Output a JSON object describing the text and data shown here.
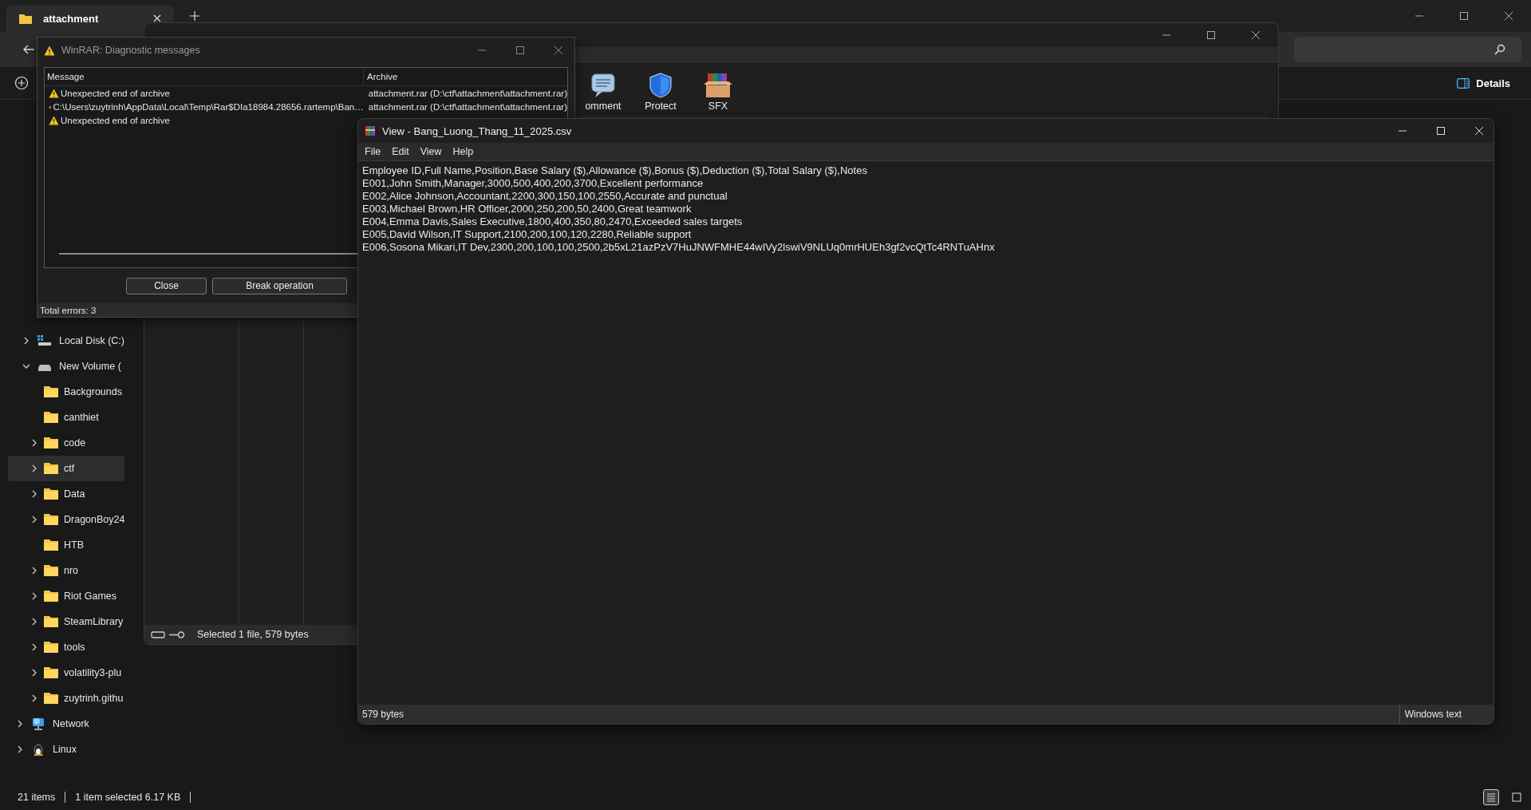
{
  "explorer": {
    "tabs": [
      {
        "label": "attachment",
        "selected": true
      }
    ],
    "details_button": "Details",
    "this_pc_children": [
      {
        "label": "Local Disk (C:)",
        "kind": "system-drive",
        "expanded": false
      },
      {
        "label": "New Volume (",
        "kind": "drive",
        "expanded": true,
        "children": [
          {
            "label": "Backgrounds",
            "has_children": false,
            "selected": false
          },
          {
            "label": "canthiet",
            "has_children": false,
            "selected": false
          },
          {
            "label": "code",
            "has_children": true,
            "selected": false
          },
          {
            "label": "ctf",
            "has_children": true,
            "selected": true
          },
          {
            "label": "Data",
            "has_children": true,
            "selected": false
          },
          {
            "label": "DragonBoy24",
            "has_children": true,
            "selected": false
          },
          {
            "label": "HTB",
            "has_children": false,
            "selected": false
          },
          {
            "label": "nro",
            "has_children": true,
            "selected": false
          },
          {
            "label": "Riot Games",
            "has_children": true,
            "selected": false
          },
          {
            "label": "SteamLibrary",
            "has_children": true,
            "selected": false
          },
          {
            "label": "tools",
            "has_children": true,
            "selected": false
          },
          {
            "label": "volatility3-plu",
            "has_children": true,
            "selected": false
          },
          {
            "label": "zuytrinh.githu",
            "has_children": true,
            "selected": false
          }
        ]
      }
    ],
    "other_locations": [
      {
        "label": "Network",
        "kind": "network",
        "expanded": false
      },
      {
        "label": "Linux",
        "kind": "linux",
        "expanded": false
      }
    ],
    "status": {
      "items": "21 items",
      "selection": "1 item selected  6.17 KB"
    },
    "view_modes": [
      {
        "kind": "details",
        "selected": true
      },
      {
        "kind": "tiles",
        "selected": false
      }
    ]
  },
  "winrar": {
    "toolbar": [
      {
        "label": "omment",
        "kind": "comment"
      },
      {
        "label": "Protect",
        "kind": "protect"
      },
      {
        "label": "SFX",
        "kind": "sfx"
      }
    ],
    "status": "Selected 1 file, 579 bytes"
  },
  "diagnostic": {
    "title": "WinRAR: Diagnostic messages",
    "columns": [
      "Message",
      "Archive"
    ],
    "rows": [
      {
        "message": "Unexpected end of archive",
        "archive": "attachment.rar (D:\\ctf\\attachment\\attachment.rar)"
      },
      {
        "message": "C:\\Users\\zuytrinh\\AppData\\Local\\Temp\\Rar$DIa18984.28656.rartemp\\Ban…",
        "archive": "attachment.rar (D:\\ctf\\attachment\\attachment.rar)"
      },
      {
        "message": "Unexpected end of archive"
      }
    ],
    "buttons": [
      "Close",
      "Break operation"
    ],
    "footer": "Total errors: 3"
  },
  "viewer": {
    "title": "View - Bang_Luong_Thang_11_2025.csv",
    "menu": [
      "File",
      "Edit",
      "View",
      "Help"
    ],
    "lines": [
      "Employee ID,Full Name,Position,Base Salary ($),Allowance ($),Bonus ($),Deduction ($),Total Salary ($),Notes",
      "E001,John Smith,Manager,3000,500,400,200,3700,Excellent performance",
      "E002,Alice Johnson,Accountant,2200,300,150,100,2550,Accurate and punctual",
      "E003,Michael Brown,HR Officer,2000,250,200,50,2400,Great teamwork",
      "E004,Emma Davis,Sales Executive,1800,400,350,80,2470,Exceeded sales targets",
      "E005,David Wilson,IT Support,2100,200,100,120,2280,Reliable support",
      "E006,Sosona Mikari,IT Dev,2300,200,100,100,2500,2b5xL21azPzV7HuJNWFMHE44wIVy2lswiV9NLUq0mrHUEh3gf2vcQtTc4RNTuAHnx"
    ],
    "status": {
      "size": "579 bytes",
      "encoding": "Windows text"
    }
  }
}
